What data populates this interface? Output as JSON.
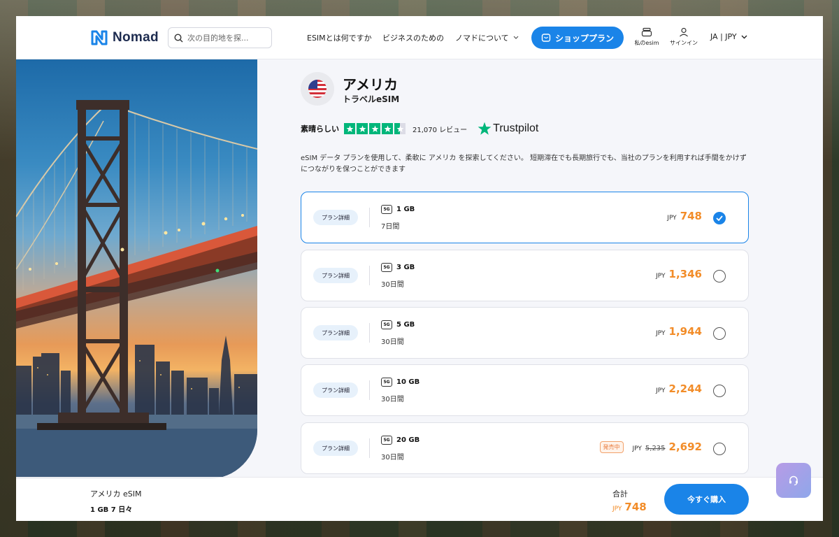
{
  "header": {
    "logo_text": "Nomad",
    "search_placeholder": "次の目的地を探...",
    "nav": {
      "what_is_esim": "ESIMとは何ですか",
      "business": "ビジネスのための",
      "about": "ノマドについて"
    },
    "shop_plan_label": "ショッププラン",
    "my_esim_label": "私のesim",
    "sign_in_label": "サインイン",
    "lang_currency": "JA | JPY"
  },
  "product": {
    "country": "アメリカ",
    "subtitle": "トラベルeSIM",
    "rating_word": "素晴らしい",
    "stars": 4.5,
    "review_count": "21,070 レビュー",
    "trustpilot": "Trustpilot",
    "description": "eSIM データ プランを使用して、柔軟に アメリカ を探索してください。 短期滞在でも長期旅行でも、当社のプランを利用すれば手間をかけずにつながりを保つことができます"
  },
  "plans": [
    {
      "detail_label": "プラン詳細",
      "network": "5G",
      "data": "1 GB",
      "days": "7日間",
      "currency": "JPY",
      "price": "748",
      "selected": true
    },
    {
      "detail_label": "プラン詳細",
      "network": "5G",
      "data": "3 GB",
      "days": "30日間",
      "currency": "JPY",
      "price": "1,346",
      "selected": false
    },
    {
      "detail_label": "プラン詳細",
      "network": "5G",
      "data": "5 GB",
      "days": "30日間",
      "currency": "JPY",
      "price": "1,944",
      "selected": false
    },
    {
      "detail_label": "プラン詳細",
      "network": "5G",
      "data": "10 GB",
      "days": "30日間",
      "currency": "JPY",
      "price": "2,244",
      "selected": false
    },
    {
      "detail_label": "プラン詳細",
      "network": "5G",
      "data": "20 GB",
      "days": "30日間",
      "currency": "JPY",
      "price": "2,692",
      "old_price": "5,235",
      "sale_label": "発売中",
      "selected": false
    }
  ],
  "bottom_bar": {
    "product_name": "アメリカ eSIM",
    "selection": "1 GB 7 日々",
    "total_label": "合計",
    "total_currency": "JPY",
    "total_price": "748",
    "buy_label": "今すぐ購入"
  },
  "colors": {
    "accent": "#1a84e8",
    "price": "#f28c28",
    "trustpilot_green": "#00b67a"
  }
}
